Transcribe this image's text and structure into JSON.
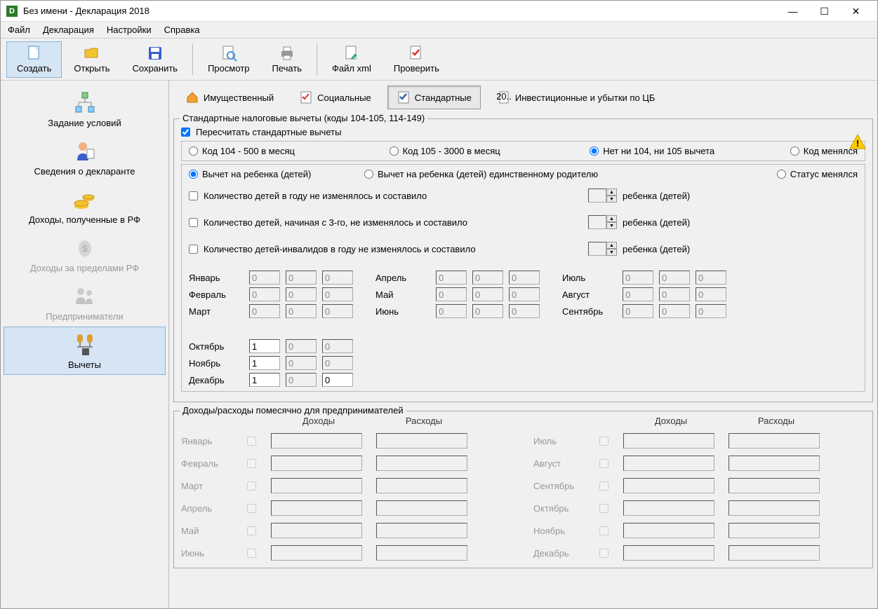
{
  "window": {
    "title": "Без имени - Декларация 2018"
  },
  "menu": {
    "file": "Файл",
    "decl": "Декларация",
    "settings": "Настройки",
    "help": "Справка"
  },
  "toolbar": {
    "create": "Создать",
    "open": "Открыть",
    "save": "Сохранить",
    "preview": "Просмотр",
    "print": "Печать",
    "xml": "Файл xml",
    "check": "Проверить"
  },
  "sidebar": {
    "conditions": "Задание условий",
    "declarant": "Сведения о декларанте",
    "income_rf": "Доходы, полученные в РФ",
    "income_abroad": "Доходы за пределами РФ",
    "entrepreneurs": "Предприниматели",
    "deductions": "Вычеты"
  },
  "tabs": {
    "property": "Имущественный",
    "social": "Социальные",
    "standard": "Стандартные",
    "invest": "Инвестиционные и убытки по ЦБ"
  },
  "std": {
    "group_title": "Стандартные налоговые вычеты (коды 104-105, 114-149)",
    "recalc": "Пересчитать стандартные вычеты",
    "code104": "Код 104 - 500 в месяц",
    "code105": "Код 105 - 3000 в месяц",
    "no104105": "Нет ни 104, ни 105 вычета",
    "code_changed": "Код менялся",
    "child": "Вычет на ребенка (детей)",
    "child_single": "Вычет на ребенка (детей) единственному родителю",
    "status_changed": "Статус менялся",
    "children_count": "Количество детей в году не изменялось и составило",
    "children_from3": "Количество детей, начиная с 3-го, не изменялось и составило",
    "children_disabled": "Количество детей-инвалидов в году не изменялось и составило",
    "children_suffix": "ребенка (детей)",
    "months": {
      "jan": "Январь",
      "feb": "Февраль",
      "mar": "Март",
      "apr": "Апрель",
      "may": "Май",
      "jun": "Июнь",
      "jul": "Июль",
      "aug": "Август",
      "sep": "Сентябрь",
      "oct": "Октябрь",
      "nov": "Ноябрь",
      "dec": "Декабрь"
    },
    "values": {
      "jan": [
        "0",
        "0",
        "0"
      ],
      "feb": [
        "0",
        "0",
        "0"
      ],
      "mar": [
        "0",
        "0",
        "0"
      ],
      "apr": [
        "0",
        "0",
        "0"
      ],
      "may": [
        "0",
        "0",
        "0"
      ],
      "jun": [
        "0",
        "0",
        "0"
      ],
      "jul": [
        "0",
        "0",
        "0"
      ],
      "aug": [
        "0",
        "0",
        "0"
      ],
      "sep": [
        "0",
        "0",
        "0"
      ],
      "oct": [
        "1",
        "0",
        "0"
      ],
      "nov": [
        "1",
        "0",
        "0"
      ],
      "dec": [
        "1",
        "0",
        "0"
      ]
    }
  },
  "ie": {
    "title": "Доходы/расходы помесячно для предпринимателей",
    "income": "Доходы",
    "expense": "Расходы"
  }
}
